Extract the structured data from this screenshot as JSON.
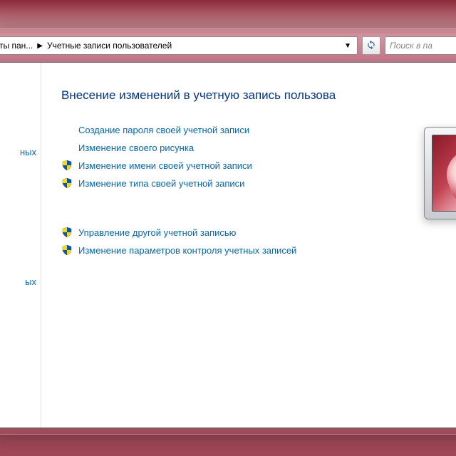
{
  "breadcrumb": {
    "item1": "ты пан...",
    "item2": "Учетные записи пользователей"
  },
  "search": {
    "placeholder": "Поиск в па"
  },
  "sidebar": {
    "item1": "ных",
    "item2": "ых"
  },
  "main": {
    "heading": "Внесение изменений в учетную запись пользова",
    "links": {
      "create_password": "Создание пароля своей учетной записи",
      "change_picture": "Изменение своего рисунка",
      "change_name": "Изменение имени своей учетной записи",
      "change_type": "Изменение типа своей учетной записи",
      "manage_other": "Управление другой учетной записью",
      "change_uac": "Изменение параметров контроля учетных записей"
    }
  }
}
